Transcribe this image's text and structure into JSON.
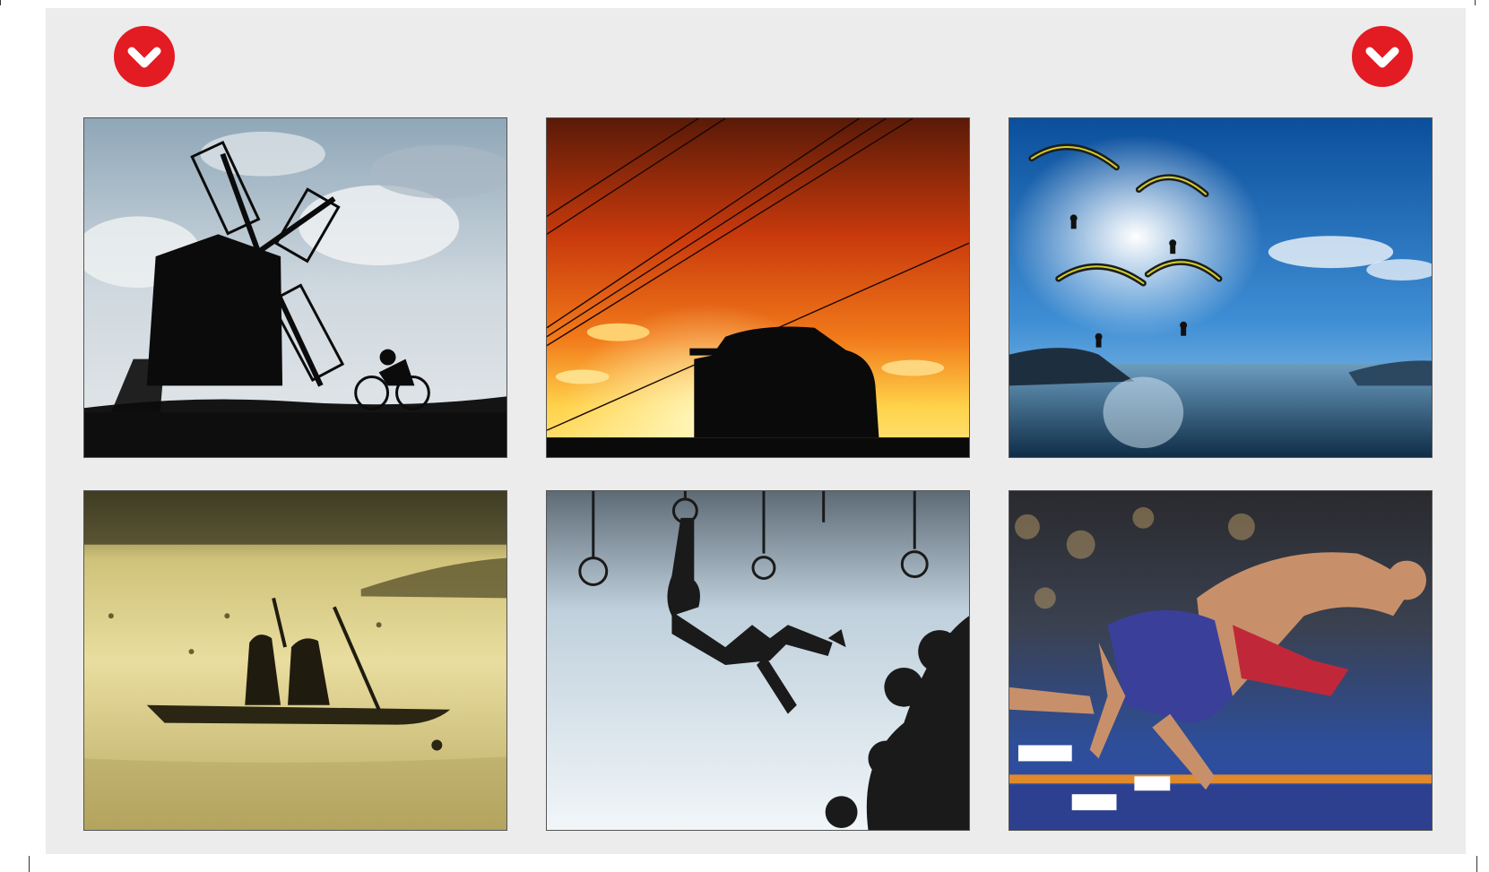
{
  "colors": {
    "accent": "#e31b23",
    "panel_bg": "#ececec"
  },
  "navigation": {
    "left_icon": "chevron-down-icon",
    "right_icon": "chevron-down-icon"
  },
  "photos": [
    {
      "subject": "windmill-cyclist-silhouette"
    },
    {
      "subject": "rally-car-sunset-silhouette"
    },
    {
      "subject": "paragliders-over-lake"
    },
    {
      "subject": "canoe-pair-misty-lake"
    },
    {
      "subject": "athlete-on-rings-silhouette"
    },
    {
      "subject": "wrestlers-throw"
    }
  ]
}
